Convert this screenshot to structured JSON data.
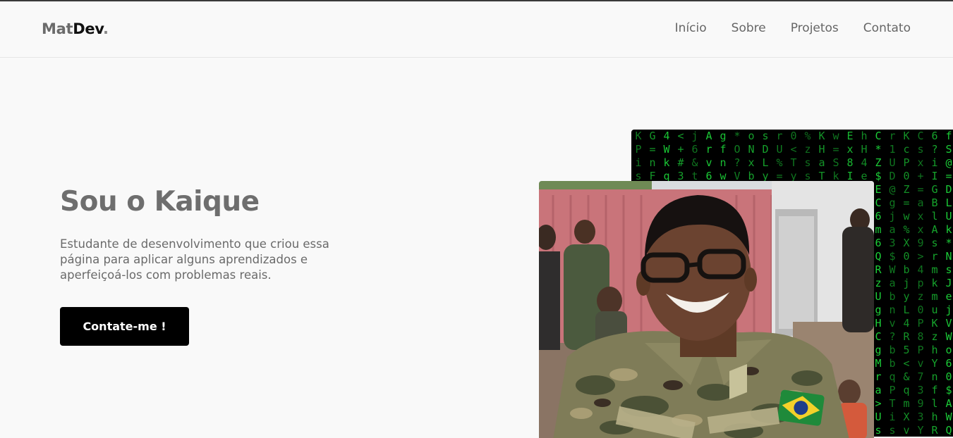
{
  "nav": {
    "logo_part1": "Mat",
    "logo_part2": "Dev",
    "logo_dot": ".",
    "links": [
      "Início",
      "Sobre",
      "Projetos",
      "Contato"
    ]
  },
  "hero": {
    "title": "Sou o Kaique",
    "description": "Estudante de desenvolvimento que criou essa página para aplicar alguns aprendizados e aperfeiçoá-los com problemas reais.",
    "cta_label": "Contate-me !"
  },
  "images": {
    "matrix_icon": "matrix-code-background",
    "photo_icon": "profile-photo",
    "matrix_color": "#1dd63a"
  }
}
